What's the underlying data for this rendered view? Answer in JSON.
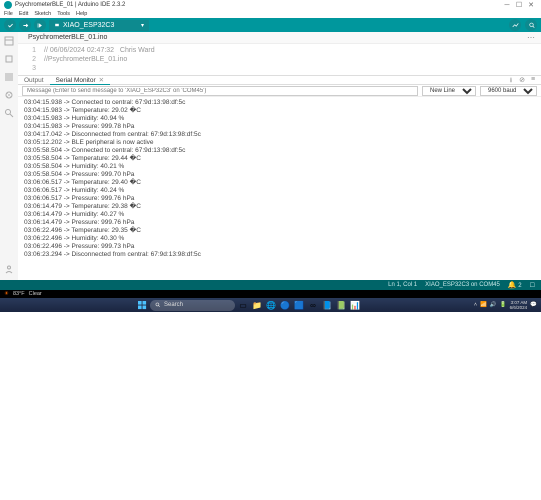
{
  "window": {
    "title": "PsychrometerBLE_01 | Arduino IDE 2.3.2"
  },
  "menu": {
    "items": [
      "File",
      "Edit",
      "Sketch",
      "Tools",
      "Help"
    ]
  },
  "board": {
    "name": "XIAO_ESP32C3"
  },
  "tab": {
    "name": "PsychrometerBLE_01.ino"
  },
  "code": {
    "lines": [
      {
        "n": "1",
        "t": "// 06/06/2024 02:47:32   Chris Ward"
      },
      {
        "n": "2",
        "t": "//PsychrometerBLE_01.ino"
      },
      {
        "n": "3",
        "t": ""
      }
    ]
  },
  "panel": {
    "tabs": {
      "output": "Output",
      "serial": "Serial Monitor"
    },
    "msg_placeholder": "Message (Enter to send message to 'XIAO_ESP32C3' on 'COM45')",
    "line_ending": "New Line",
    "baud": "9600 baud"
  },
  "serial": {
    "rows": [
      "03:04:15.938 -> Connected to central: 67:9d:13:98:df:5c",
      "03:04:15.983 -> Temperature: 29.02 �C",
      "03:04:15.983 -> Humidity: 40.94 %",
      "03:04:15.983 -> Pressure: 999.78 hPa",
      "03:04:17.042 -> Disconnected from central: 67:9d:13:98:df:5c",
      "03:05:12.202 -> BLE peripheral is now active",
      "03:05:58.504 -> Connected to central: 67:9d:13:98:df:5c",
      "03:05:58.504 -> Temperature: 29.44 �C",
      "03:05:58.504 -> Humidity: 40.21 %",
      "03:05:58.504 -> Pressure: 999.70 hPa",
      "03:06:06.517 -> Temperature: 29.40 �C",
      "03:06:06.517 -> Humidity: 40.24 %",
      "03:06:06.517 -> Pressure: 999.76 hPa",
      "03:06:14.479 -> Temperature: 29.38 �C",
      "03:06:14.479 -> Humidity: 40.27 %",
      "03:06:14.479 -> Pressure: 999.76 hPa",
      "03:06:22.496 -> Temperature: 29.35 �C",
      "03:06:22.496 -> Humidity: 40.30 %",
      "03:06:22.496 -> Pressure: 999.73 hPa",
      "03:06:23.294 -> Disconnected from central: 67:9d:13:98:df:5c"
    ]
  },
  "status": {
    "pos": "Ln 1, Col 1",
    "board": "XIAO_ESP32C3 on COM45",
    "notif": "2"
  },
  "b4a": {
    "temp": "83°F",
    "label": "Clear"
  },
  "search": {
    "placeholder": "Search"
  },
  "clock": {
    "time": "3:07 AM",
    "date": "6/6/2024"
  }
}
